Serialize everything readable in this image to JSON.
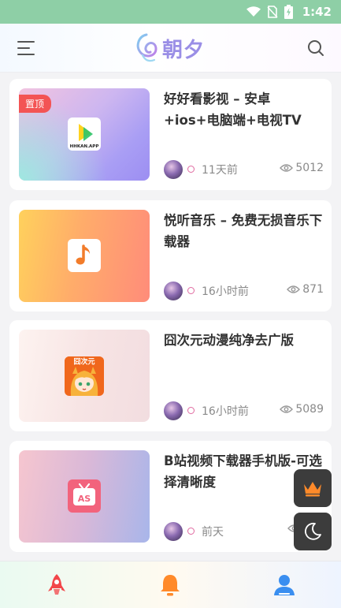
{
  "status_bar": {
    "time": "1:42"
  },
  "header": {
    "logo_text": "朝夕"
  },
  "posts": [
    {
      "title": "好好看影视 – 安卓+ios+电脑端+电视TV四...",
      "pinned": true,
      "pin_label": "置顶",
      "time": "11天前",
      "views": "5012",
      "app_icon": "haohaokan-app-icon",
      "app_icon_text": "HHKAN.APP"
    },
    {
      "title": "悦听音乐 – 免费无损音乐下载器",
      "pinned": false,
      "time": "16小时前",
      "views": "871",
      "app_icon": "music-note-app-icon"
    },
    {
      "title": "囧次元动漫纯净去广版",
      "pinned": false,
      "time": "16小时前",
      "views": "5089",
      "app_icon": "jiongciyuan-app-icon",
      "app_icon_text": "囧次元"
    },
    {
      "title": "B站视频下载器手机版-可选择清晰度",
      "pinned": false,
      "time": "前天",
      "views": "",
      "app_icon": "bili-download-app-icon",
      "app_icon_text": "AS"
    }
  ],
  "floating": {
    "top": "crown-icon",
    "bottom": "moon-icon"
  },
  "tabbar": {
    "items": [
      "rocket-icon",
      "bell-icon",
      "user-icon"
    ]
  },
  "colors": {
    "status_bar": "#8ecfa6",
    "accent": "#9a8ee6",
    "pin": "#f35454"
  }
}
